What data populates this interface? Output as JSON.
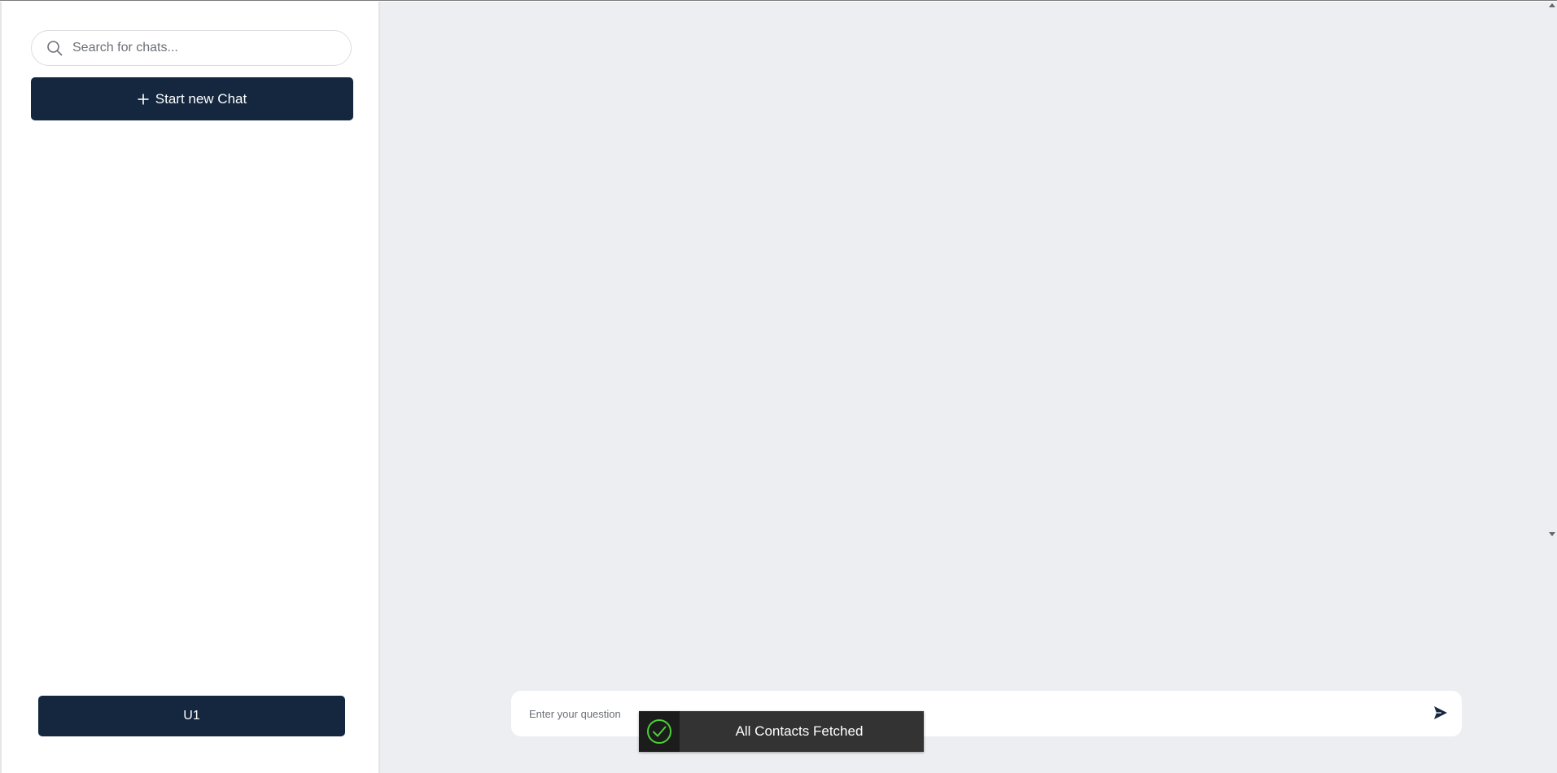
{
  "sidebar": {
    "search": {
      "placeholder": "Search for chats...",
      "value": ""
    },
    "new_chat_label": "Start new Chat",
    "user_label": "U1"
  },
  "main": {
    "question": {
      "placeholder": "Enter your question",
      "value": ""
    }
  },
  "toast": {
    "message": "All Contacts Fetched",
    "status": "success"
  },
  "icons": {
    "search": "search-icon",
    "plus": "plus-icon",
    "send": "send-icon",
    "check": "check-circle-icon"
  },
  "colors": {
    "primary": "#14273f",
    "main_background": "#edeef1",
    "toast_background": "#333333",
    "success": "#4cd137"
  }
}
